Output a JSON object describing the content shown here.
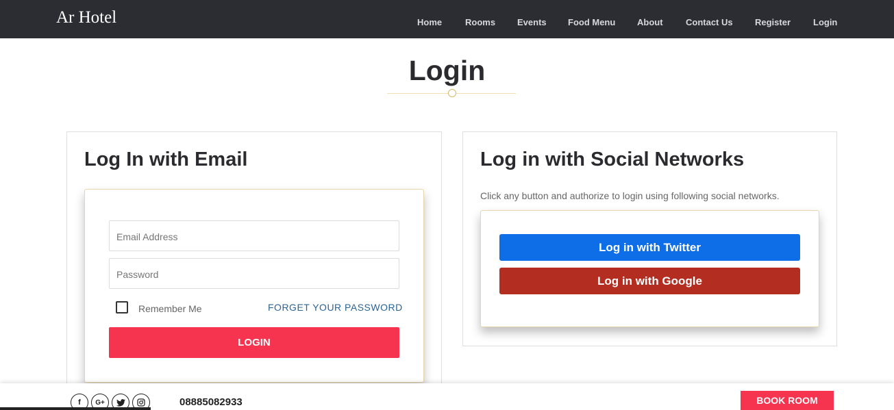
{
  "brand": "Ar Hotel",
  "nav": {
    "items": [
      "Home",
      "Rooms",
      "Events",
      "Food Menu",
      "About",
      "Contact Us",
      "Register",
      "Login"
    ]
  },
  "page": {
    "title": "Login"
  },
  "email_panel": {
    "heading": "Log In with Email",
    "email_placeholder": "Email Address",
    "password_placeholder": "Password",
    "remember_label": "Remember Me",
    "remember_checked": false,
    "forget_label": "FORGET YOUR PASSWORD",
    "login_button": "LOGIN"
  },
  "social_panel": {
    "heading": "Log in with Social Networks",
    "description": "Click any button and authorize to login using following social networks.",
    "twitter_button": "Log in with Twitter",
    "google_button": "Log in with Google"
  },
  "footer": {
    "phone": "08885082933",
    "book_button": "BOOK ROOM",
    "social_icons": [
      "facebook-icon",
      "google-plus-icon",
      "twitter-icon",
      "instagram-icon"
    ]
  },
  "colors": {
    "nav_bg": "#2c2c33",
    "accent": "#f63450",
    "twitter": "#0d6ee8",
    "google": "#b42d21",
    "gold": "#d7b86a"
  }
}
